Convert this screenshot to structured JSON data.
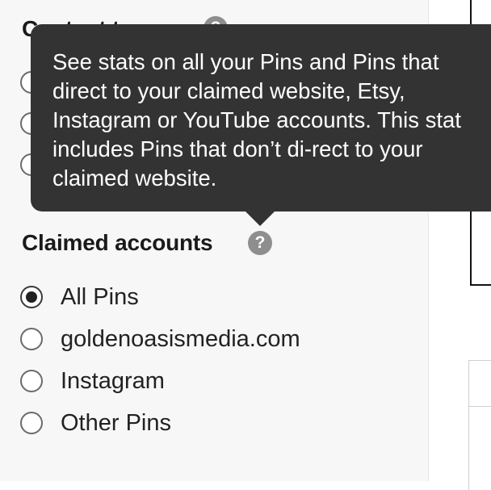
{
  "content_type_section": {
    "title": "Content type",
    "help_icon": "question-icon"
  },
  "tooltip": {
    "text": "See stats on all your Pins and Pins that direct to your claimed website, Etsy, Instagram or YouTube accounts. This stat includes Pins that don’t di-rect to your claimed website."
  },
  "claimed_accounts": {
    "title": "Claimed accounts",
    "help_icon": "question-icon",
    "options": [
      {
        "label": "All Pins",
        "selected": true
      },
      {
        "label": "goldenoasismedia.com",
        "selected": false
      },
      {
        "label": "Instagram",
        "selected": false
      },
      {
        "label": "Other Pins",
        "selected": false
      }
    ]
  }
}
